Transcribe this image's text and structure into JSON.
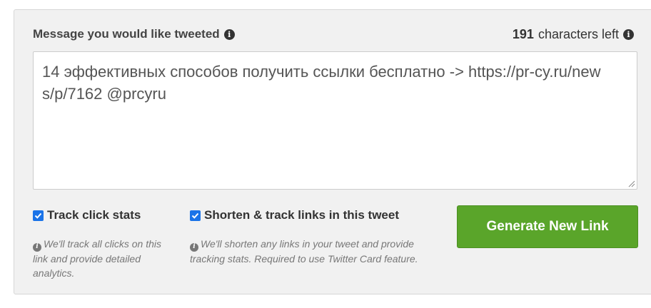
{
  "message": {
    "label": "Message you would like tweeted",
    "value": "14 эффективных способов получить ссылки бесплатно -> https://pr-cy.ru/news/p/7162 @prcyru"
  },
  "counter": {
    "count": "191",
    "suffix": "characters left"
  },
  "options": {
    "track_clicks": {
      "label": "Track click stats",
      "checked": true,
      "help": "We'll track all clicks on this link and provide detailed analytics."
    },
    "shorten_links": {
      "label": "Shorten & track links in this tweet",
      "checked": true,
      "help": "We'll shorten any links in your tweet and provide tracking stats. Required to use Twitter Card feature."
    }
  },
  "generate_button": {
    "label": "Generate New Link"
  },
  "colors": {
    "button": "#5aa52a",
    "checkbox": "#1a73e8",
    "panel": "#f1f1f1"
  },
  "icons": [
    "info-icon",
    "checkbox-checked-icon",
    "resize-grip-icon"
  ]
}
